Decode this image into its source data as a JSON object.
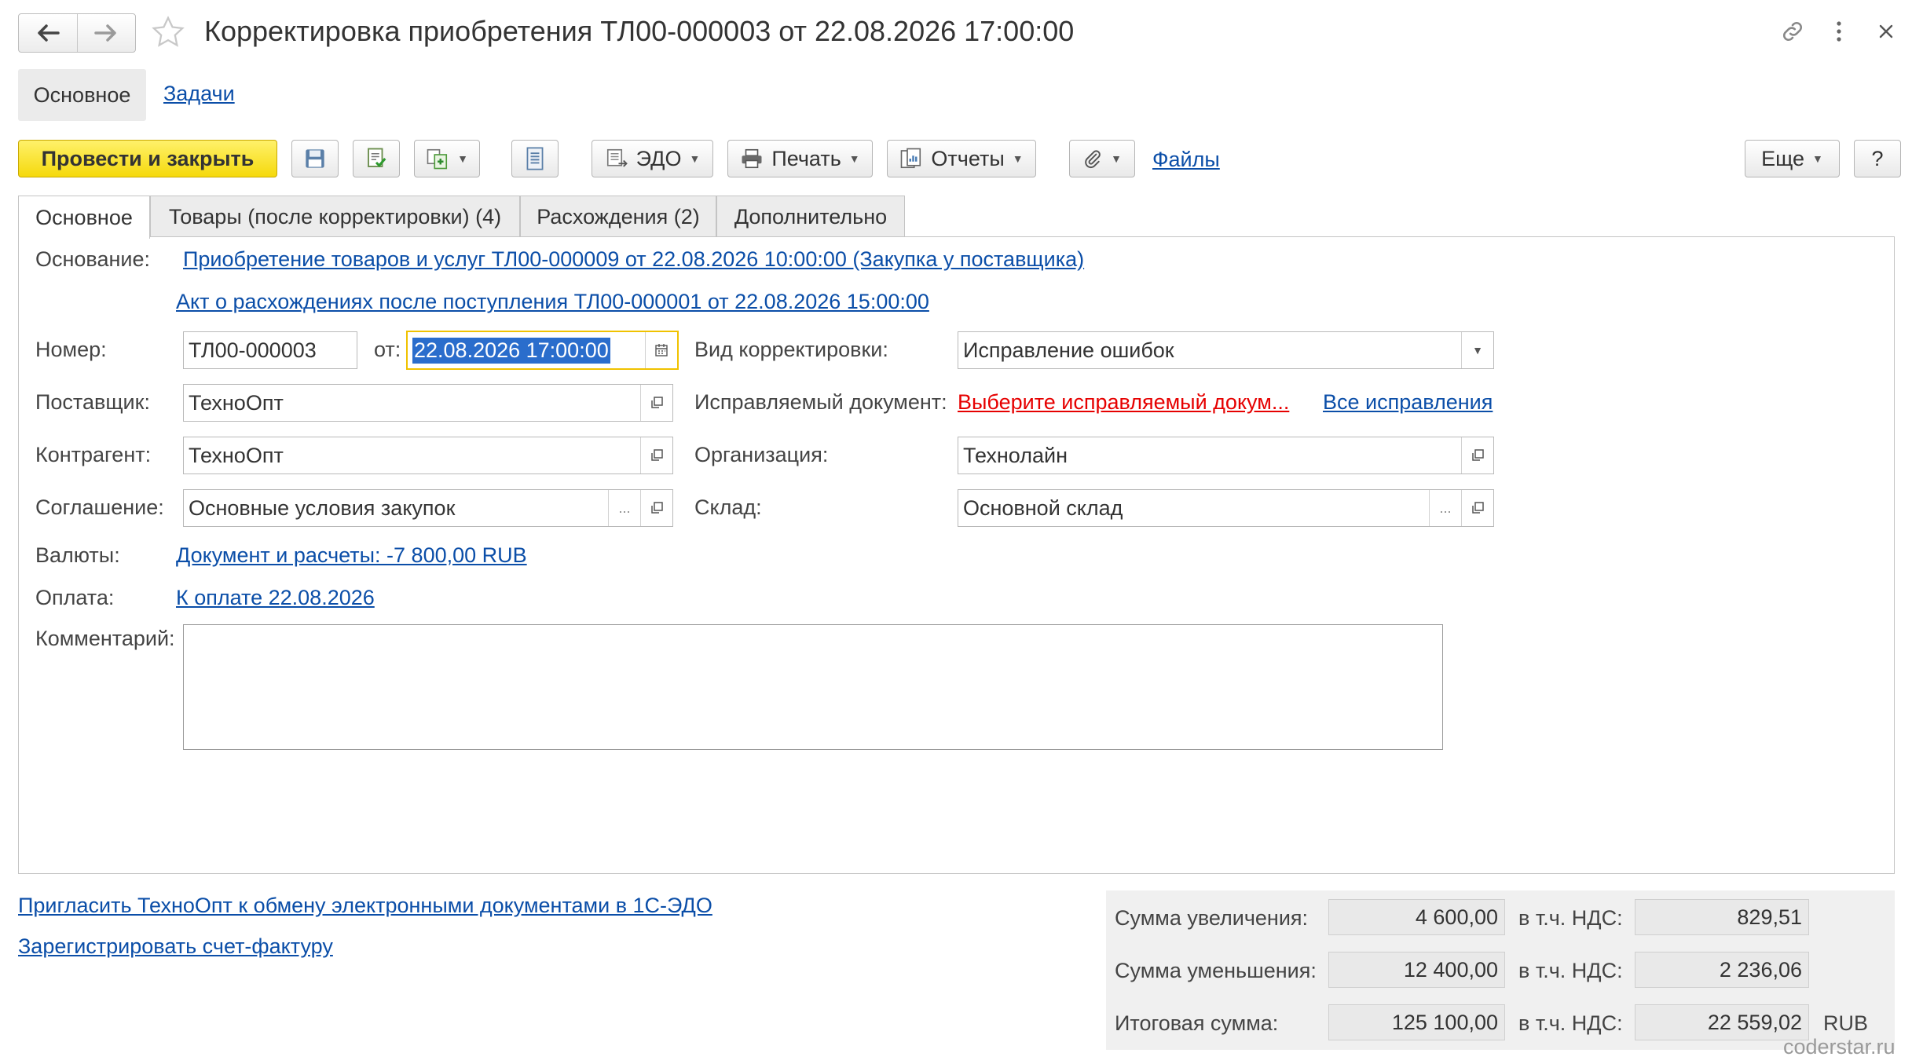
{
  "header": {
    "title": "Корректировка приобретения ТЛ00-000003 от 22.08.2026 17:00:00",
    "back_icon": "arrow-left-icon",
    "forward_icon": "arrow-right-icon",
    "favorite_icon": "star-outline-icon",
    "link_icon": "link-icon",
    "more_icon": "kebab-menu-icon",
    "close_icon": "close-icon"
  },
  "sections": {
    "main": "Основное",
    "tasks": "Задачи"
  },
  "toolbar": {
    "post_close": "Провести и закрыть",
    "edo": "ЭДО",
    "print": "Печать",
    "reports": "Отчеты",
    "files": "Файлы",
    "more": "Еще",
    "help": "?"
  },
  "tabs": [
    {
      "label": "Основное"
    },
    {
      "label": "Товары (после корректировки) (4)"
    },
    {
      "label": "Расхождения (2)"
    },
    {
      "label": "Дополнительно"
    }
  ],
  "form": {
    "basis_label": "Основание:",
    "basis_link1": "Приобретение товаров и услуг ТЛ00-000009 от 22.08.2026 10:00:00 (Закупка у поставщика)",
    "basis_link2": "Акт о расхождениях после поступления ТЛ00-000001 от 22.08.2026 15:00:00",
    "number_label": "Номер:",
    "number_value": "ТЛ00-000003",
    "date_label": "от:",
    "date_value": "22.08.2026 17:00:00",
    "kind_label": "Вид корректировки:",
    "kind_value": "Исправление ошибок",
    "supplier_label": "Поставщик:",
    "supplier_value": "ТехноОпт",
    "corrected_doc_label": "Исправляемый документ:",
    "corrected_doc_link": "Выберите исправляемый докум...",
    "all_corrections_link": "Все исправления",
    "counterparty_label": "Контрагент:",
    "counterparty_value": "ТехноОпт",
    "organization_label": "Организация:",
    "organization_value": "Технолайн",
    "agreement_label": "Соглашение:",
    "agreement_value": "Основные условия закупок",
    "warehouse_label": "Склад:",
    "warehouse_value": "Основной склад",
    "currency_label": "Валюты:",
    "currency_link": "Документ и расчеты: -7 800,00 RUB",
    "payment_label": "Оплата:",
    "payment_link": "К оплате 22.08.2026",
    "comment_label": "Комментарий:",
    "comment_value": ""
  },
  "bottom_links": {
    "invite": "Пригласить ТехноОпт к обмену электронными документами в 1С-ЭДО",
    "register_invoice": "Зарегистрировать счет-фактуру"
  },
  "totals": {
    "increase_label": "Сумма увеличения:",
    "increase_value": "4 600,00",
    "increase_vat_label": "в т.ч. НДС:",
    "increase_vat_value": "829,51",
    "decrease_label": "Сумма уменьшения:",
    "decrease_value": "12 400,00",
    "decrease_vat_label": "в т.ч. НДС:",
    "decrease_vat_value": "2 236,06",
    "total_label": "Итоговая сумма:",
    "total_value": "125 100,00",
    "total_vat_label": "в т.ч. НДС:",
    "total_vat_value": "22 559,02",
    "currency": "RUB"
  },
  "watermark": "coderstar.ru"
}
